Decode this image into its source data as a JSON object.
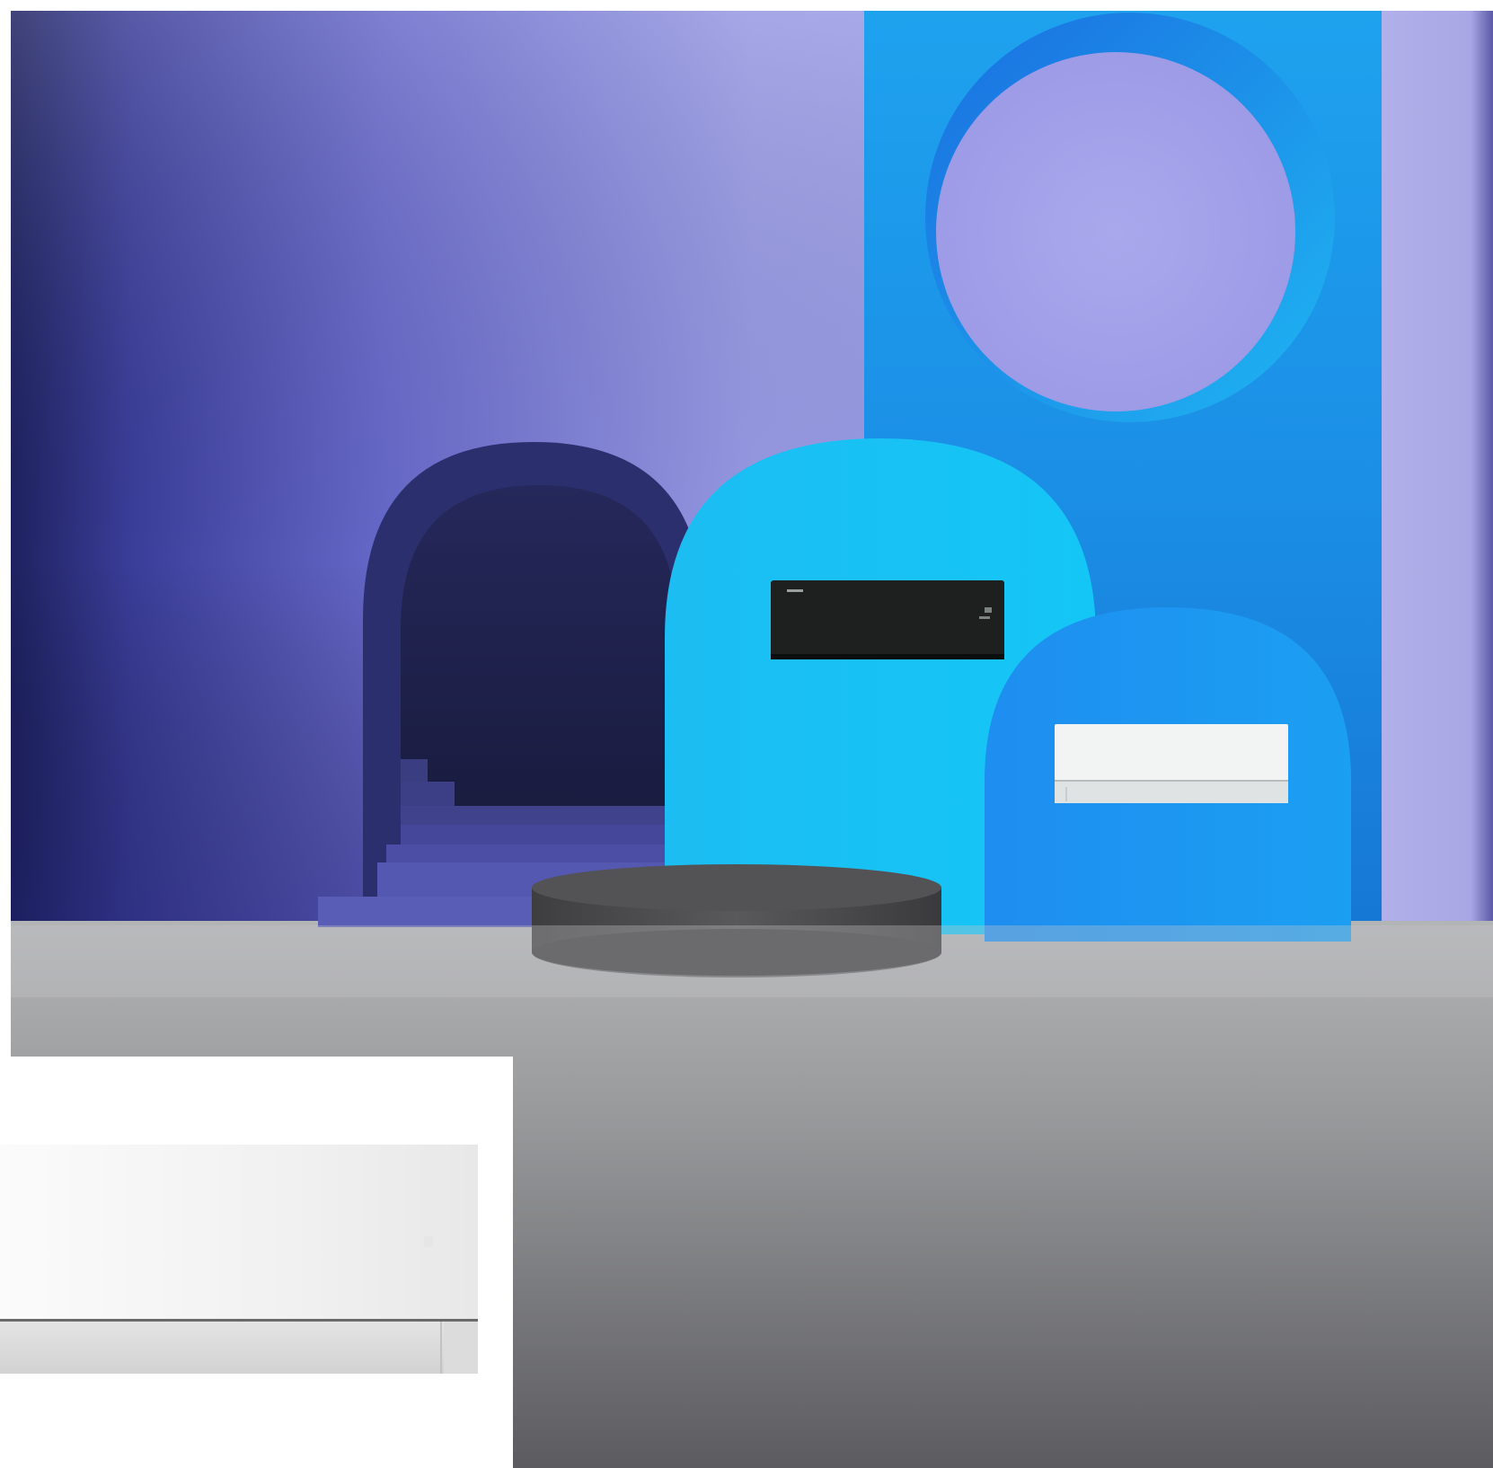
{
  "scene": {
    "colors": {
      "wall_violet": "#8e90e0",
      "wall_dark": "#2a2f7a",
      "panel_blue": "#1a8ee8",
      "arch_cyan": "#1cc6f5",
      "arch_blue": "#1f9bf0",
      "floor": "#9c9c9c",
      "pedestal": "#4a4a4c",
      "unit_black": "#1d1f1f",
      "unit_white": "#f3f4f4"
    },
    "objects": [
      "violet-wall",
      "blue-panel-with-circular-opening",
      "dark-archway-with-stairs",
      "cyan-arch",
      "blue-arch",
      "black-air-conditioner-unit",
      "white-air-conditioner-unit",
      "round-concrete-pedestal",
      "concrete-floor"
    ]
  },
  "inset": {
    "object": "white-air-conditioner-closeup",
    "background": "#ffffff"
  }
}
